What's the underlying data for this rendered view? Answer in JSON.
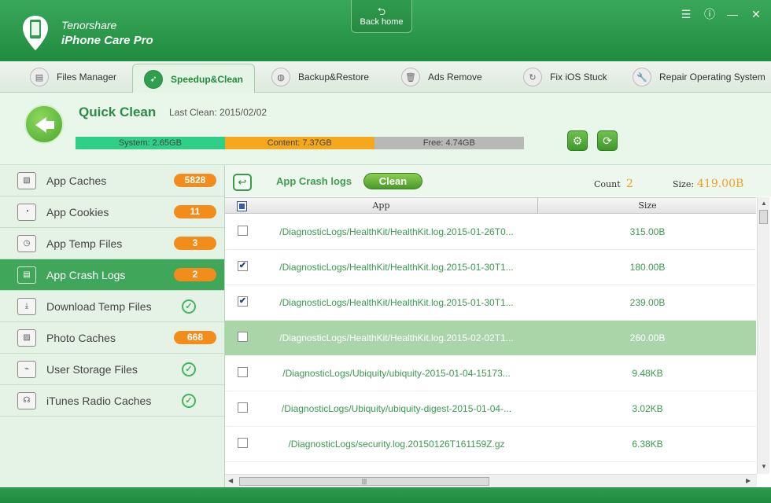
{
  "app": {
    "brand_line1": "Tenorshare",
    "brand_line2": "iPhone Care Pro",
    "back_home": "Back home",
    "window_controls": [
      "menu-icon",
      "info-icon",
      "minimize-icon",
      "close-icon"
    ]
  },
  "tabs": [
    {
      "label": "Files Manager",
      "icon": "files-icon",
      "active": false
    },
    {
      "label": "Speedup&Clean",
      "icon": "rocket-icon",
      "active": true
    },
    {
      "label": "Backup&Restore",
      "icon": "backup-icon",
      "active": false
    },
    {
      "label": "Ads Remove",
      "icon": "trash-icon",
      "active": false
    },
    {
      "label": "Fix iOS Stuck",
      "icon": "refresh-icon",
      "active": false
    },
    {
      "label": "Repair Operating System",
      "icon": "wrench-icon",
      "active": false
    }
  ],
  "quick_clean": {
    "title": "Quick Clean",
    "last_clean": "Last Clean: 2015/02/02",
    "storage": [
      {
        "label": "System: 2.65GB",
        "color": "#2fcf88",
        "fraction": 0.333
      },
      {
        "label": "Content: 7.37GB",
        "color": "#f4a81e",
        "fraction": 0.333
      },
      {
        "label": "Free: 4.74GB",
        "color": "#b8b8b8",
        "fraction": 0.334
      }
    ]
  },
  "sidebar": {
    "items": [
      {
        "label": "App Caches",
        "badge": "5828",
        "done": false,
        "active": false
      },
      {
        "label": "App Cookies",
        "badge": "11",
        "done": false,
        "active": false
      },
      {
        "label": "App Temp Files",
        "badge": "3",
        "done": false,
        "active": false
      },
      {
        "label": "App Crash Logs",
        "badge": "2",
        "done": false,
        "active": true
      },
      {
        "label": "Download Temp Files",
        "badge": "",
        "done": true,
        "active": false
      },
      {
        "label": "Photo Caches",
        "badge": "668",
        "done": false,
        "active": false
      },
      {
        "label": "User Storage Files",
        "badge": "",
        "done": true,
        "active": false
      },
      {
        "label": "iTunes Radio Caches",
        "badge": "",
        "done": true,
        "active": false
      }
    ]
  },
  "content": {
    "title": "App Crash logs",
    "clean_label": "Clean",
    "count_label": "Count",
    "count_value": "2",
    "size_label": "Size:",
    "size_value": "419.00B",
    "columns": {
      "app": "App",
      "size": "Size"
    },
    "rows": [
      {
        "app": "/DiagnosticLogs/HealthKit/HealthKit.log.2015-01-26T0...",
        "size": "315.00B",
        "checked": false,
        "selected": false
      },
      {
        "app": "/DiagnosticLogs/HealthKit/HealthKit.log.2015-01-30T1...",
        "size": "180.00B",
        "checked": true,
        "selected": false
      },
      {
        "app": "/DiagnosticLogs/HealthKit/HealthKit.log.2015-01-30T1...",
        "size": "239.00B",
        "checked": true,
        "selected": false
      },
      {
        "app": "/DiagnosticLogs/HealthKit/HealthKit.log.2015-02-02T1...",
        "size": "260.00B",
        "checked": false,
        "selected": true
      },
      {
        "app": "/DiagnosticLogs/Ubiquity/ubiquity-2015-01-04-15173...",
        "size": "9.48KB",
        "checked": false,
        "selected": false
      },
      {
        "app": "/DiagnosticLogs/Ubiquity/ubiquity-digest-2015-01-04-...",
        "size": "3.02KB",
        "checked": false,
        "selected": false
      },
      {
        "app": "/DiagnosticLogs/security.log.20150126T161159Z.gz",
        "size": "6.38KB",
        "checked": false,
        "selected": false
      }
    ]
  }
}
